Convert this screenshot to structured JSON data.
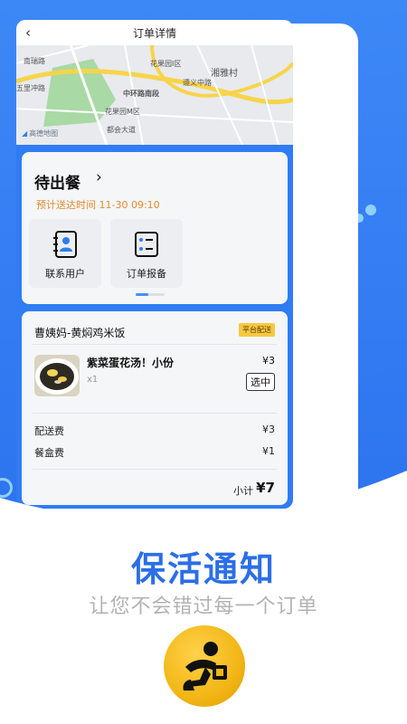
{
  "nav": {
    "title": "订单详情"
  },
  "map": {
    "labels": [
      "花果园I区",
      "湘雅村",
      "中环路南段",
      "遵义中路",
      "五里冲路",
      "花果园M区",
      "都会大道",
      "南瑞路"
    ],
    "provider": "高德地图"
  },
  "status": {
    "title": "待出餐",
    "eta": "预计送达时间 11-30 09:10",
    "actions": [
      {
        "label": "联系用户",
        "icon": "contacts-icon"
      },
      {
        "label": "订单报备",
        "icon": "checklist-icon"
      }
    ]
  },
  "order": {
    "shop": "曹姨妈-黄焖鸡米饭",
    "badge": "平台配送",
    "item": {
      "name": "紫菜蛋花汤！小份",
      "qty": "x1",
      "price": "¥3",
      "tag": "选中"
    },
    "fees": [
      {
        "label": "配送费",
        "value": "¥3"
      },
      {
        "label": "餐盒费",
        "value": "¥1"
      }
    ],
    "subtotal_label": "小计",
    "subtotal_value": "¥7"
  },
  "promo": {
    "headline": "保活通知",
    "subline": "让您不会错过每一个订单"
  },
  "colors": {
    "primary": "#2f7cf4",
    "headline": "#2b6fe6",
    "eta": "#e38a2c",
    "badge": "#f7c841"
  }
}
